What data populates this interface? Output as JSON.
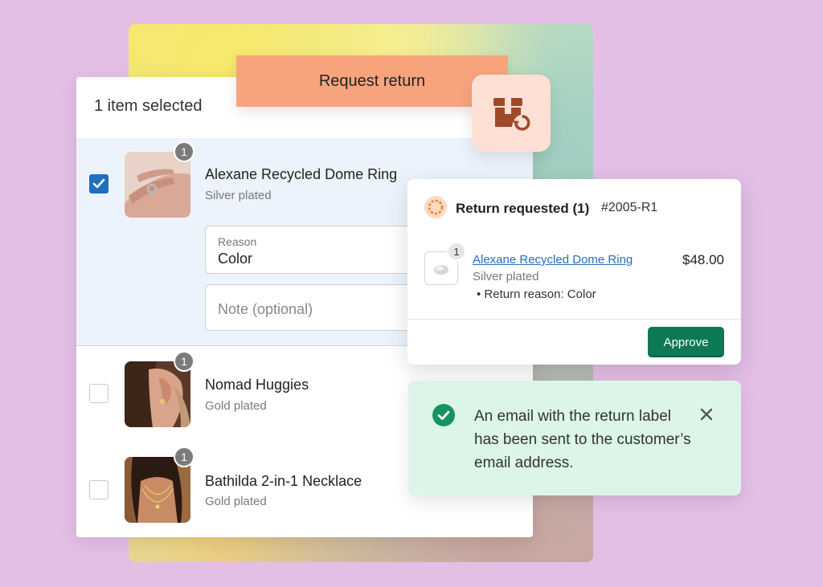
{
  "request_return": {
    "label": "Request return"
  },
  "selection": {
    "header": "1 item selected"
  },
  "items": [
    {
      "name": "Alexane Recycled Dome Ring",
      "variant": "Silver plated",
      "quantity": "1",
      "checked": true,
      "reason_label": "Reason",
      "reason_value": "Color",
      "note_placeholder": "Note (optional)"
    },
    {
      "name": "Nomad Huggies",
      "variant": "Gold plated",
      "quantity": "1",
      "checked": false
    },
    {
      "name": "Bathilda 2-in-1 Necklace",
      "variant": "Gold plated",
      "quantity": "1",
      "checked": false
    }
  ],
  "return_card": {
    "title": "Return requested (1)",
    "order_number": "#2005-R1",
    "item_name": "Alexane Recycled Dome Ring",
    "item_quantity": "1",
    "item_variant": "Silver plated",
    "item_price": "$48.00",
    "reason": "Return reason: Color",
    "approve_label": "Approve"
  },
  "toast": {
    "message": "An email with the return label has been sent to the customer’s email address."
  },
  "colors": {
    "background": "#e3bfe6",
    "accent_peach": "#f7a47d",
    "primary_green": "#0b7a55",
    "toast_bg": "#dcf5e8",
    "checkbox_blue": "#1f6fbf",
    "link_blue": "#2b6cbf"
  },
  "icons": {
    "return_box": "box-return-icon",
    "status": "progress-circle-icon",
    "success": "check-circle-icon",
    "close": "close-icon",
    "checkmark": "checkmark-icon"
  }
}
